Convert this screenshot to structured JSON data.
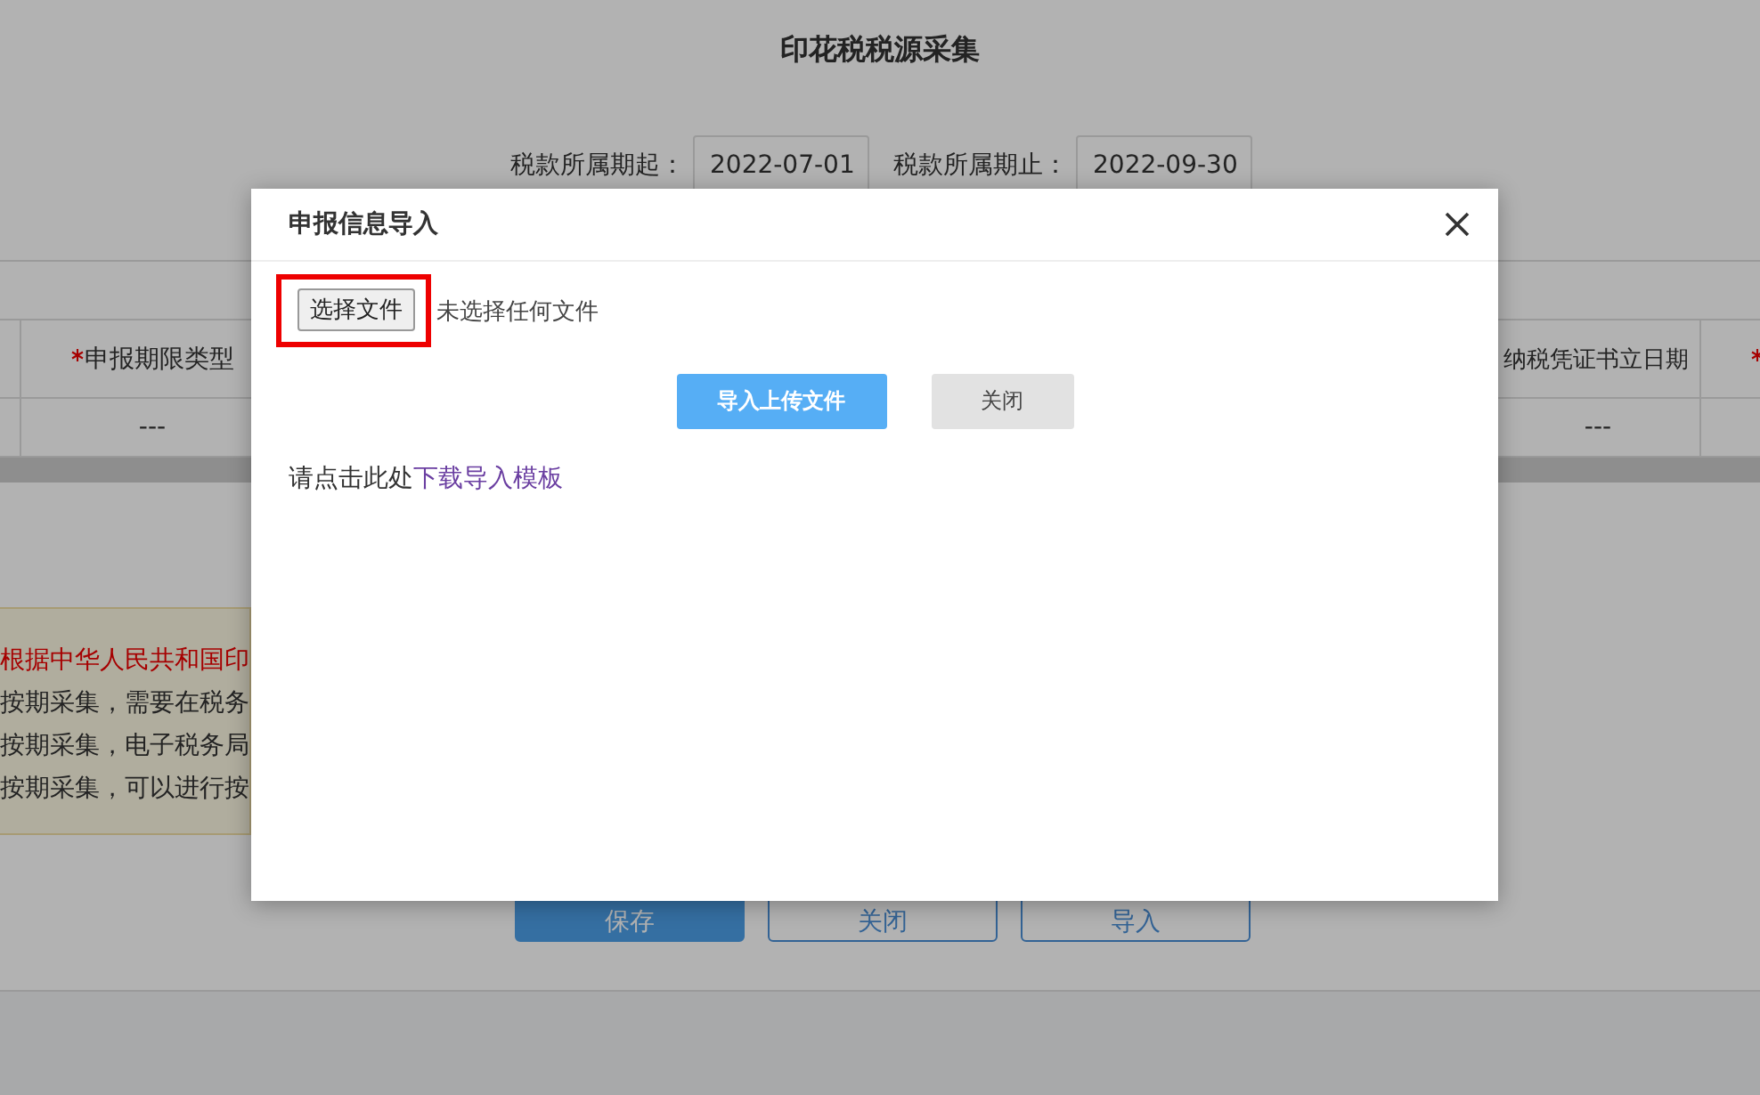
{
  "page": {
    "title": "印花税税源采集",
    "period_fields": [
      {
        "label": "税款所属期起：",
        "value": "2022-07-01"
      },
      {
        "label": "税款所属期止：",
        "value": "2022-09-30"
      }
    ],
    "table": {
      "columns": [
        {
          "label": "申报期限类型",
          "required": true
        },
        {
          "label": "纳税凭证书立日期",
          "required": false
        },
        {
          "required": true
        }
      ],
      "rows": [
        [
          "---",
          "---"
        ]
      ]
    },
    "notice": [
      {
        "kind": "alert",
        "text": "根据中华人民共和国印"
      },
      {
        "kind": "plain",
        "text": "按期采集，需要在税务"
      },
      {
        "kind": "plain",
        "text": "按期采集，电子税务局"
      },
      {
        "kind": "plain",
        "text": "按期采集，可以进行按"
      }
    ],
    "buttons": [
      {
        "label": "保存",
        "kind": "primary"
      },
      {
        "label": "关闭",
        "kind": "outline"
      },
      {
        "label": "导入",
        "kind": "outline"
      }
    ]
  },
  "dialog": {
    "title": "申报信息导入",
    "file_button": "选择文件",
    "file_status": "未选择任何文件",
    "file_highlighted": true,
    "actions": [
      {
        "label": "导入上传文件",
        "kind": "primary"
      },
      {
        "label": "关闭",
        "kind": "secondary"
      }
    ],
    "hint": "请点击此处",
    "link": "下载导入模板"
  }
}
